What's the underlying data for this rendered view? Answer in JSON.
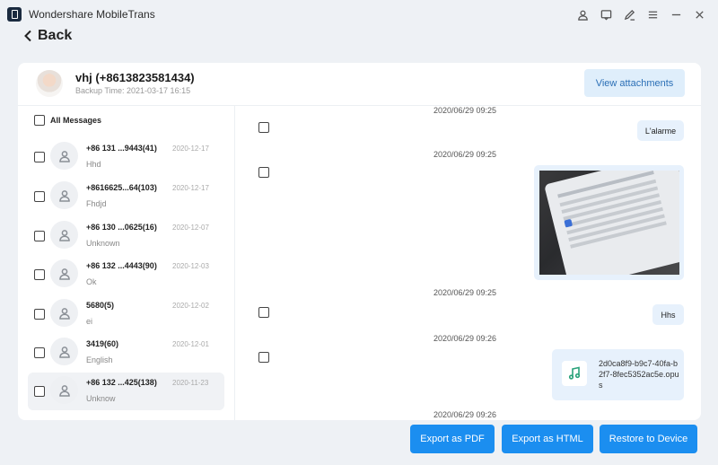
{
  "app": {
    "title": "Wondershare MobileTrans"
  },
  "titlebar_icons": [
    "user-icon",
    "feedback-icon",
    "edit-icon",
    "menu-icon",
    "minimize-icon",
    "close-icon"
  ],
  "nav": {
    "back_label": "Back"
  },
  "contact": {
    "name": "vhj (+8613823581434)",
    "backup_time": "Backup Time: 2021-03-17 16:15"
  },
  "actions": {
    "view_attachments": "View attachments"
  },
  "conversations": {
    "all_label": "All Messages",
    "items": [
      {
        "title": "+86 131 ...9443(41)",
        "date": "2020-12-17",
        "preview": "Hhd"
      },
      {
        "title": "+8616625...64(103)",
        "date": "2020-12-17",
        "preview": "Fhdjd"
      },
      {
        "title": "+86 130 ...0625(16)",
        "date": "2020-12-07",
        "preview": "Unknown"
      },
      {
        "title": "+86 132 ...4443(90)",
        "date": "2020-12-03",
        "preview": "Ok"
      },
      {
        "title": "5680(5)",
        "date": "2020-12-02",
        "preview": "ei"
      },
      {
        "title": "3419(60)",
        "date": "2020-12-01",
        "preview": "English"
      },
      {
        "title": "+86 132 ...425(138)",
        "date": "2020-11-23",
        "preview": "Unknow"
      }
    ]
  },
  "messages": [
    {
      "timestamp": "2020/06/29 09:25",
      "text": "L'alarme"
    },
    {
      "timestamp": "2020/06/29 09:25",
      "type": "image"
    },
    {
      "timestamp": "2020/06/29 09:25",
      "text": "Hhs"
    },
    {
      "timestamp": "2020/06/29 09:26",
      "type": "file",
      "filename": "2d0ca8f9-b9c7-40fa-b2f7-8fec5352ac5e.opus"
    },
    {
      "timestamp": "2020/06/29 09:26"
    }
  ],
  "footer": {
    "export_pdf": "Export as PDF",
    "export_html": "Export as HTML",
    "restore": "Restore to Device"
  },
  "colors": {
    "primary": "#1b8ef0",
    "bubble": "#e7f1fc",
    "selected_row": "#f0f2f5"
  }
}
